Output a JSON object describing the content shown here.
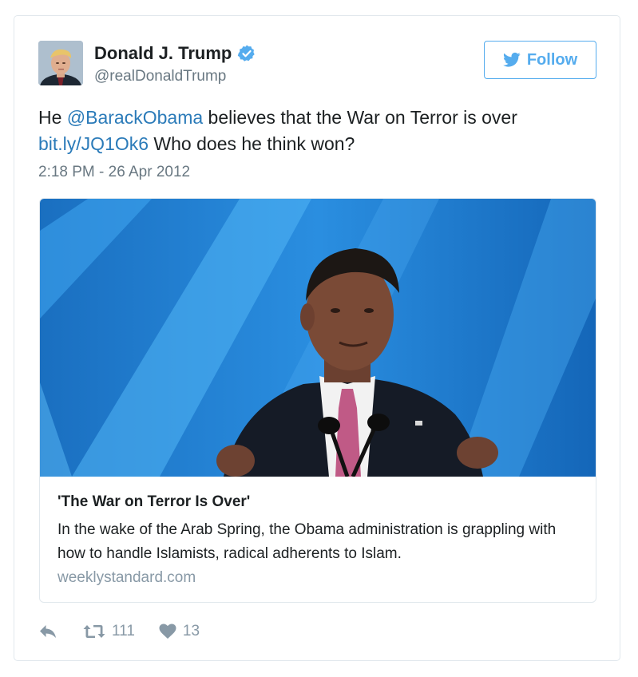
{
  "author": {
    "display_name": "Donald J. Trump",
    "handle": "@realDonaldTrump",
    "verified": true
  },
  "follow_button": {
    "label": "Follow"
  },
  "tweet": {
    "text_prefix": "He ",
    "mention": "@BarackObama",
    "text_middle": " believes that the War on Terror is over ",
    "link": "bit.ly/JQ1Ok6",
    "text_suffix": " Who does he think won?",
    "timestamp": "2:18 PM - 26 Apr 2012"
  },
  "card": {
    "title": "'The War on Terror Is Over'",
    "description": "In the wake of the Arab Spring, the Obama administration is grappling with how to handle Islamists, radical adherents to Islam.",
    "domain": "weeklystandard.com"
  },
  "actions": {
    "retweet_count": "111",
    "like_count": "13"
  },
  "icons": {
    "verified": "verified-badge-icon",
    "follow": "twitter-bird-icon",
    "reply": "reply-icon",
    "retweet": "retweet-icon",
    "like": "heart-icon"
  },
  "colors": {
    "link": "#2b7bb9",
    "twitter_blue": "#55acee",
    "secondary_text": "#697882",
    "action_gray": "#8899a6",
    "card_stage_blue": "#1f7fd0"
  }
}
